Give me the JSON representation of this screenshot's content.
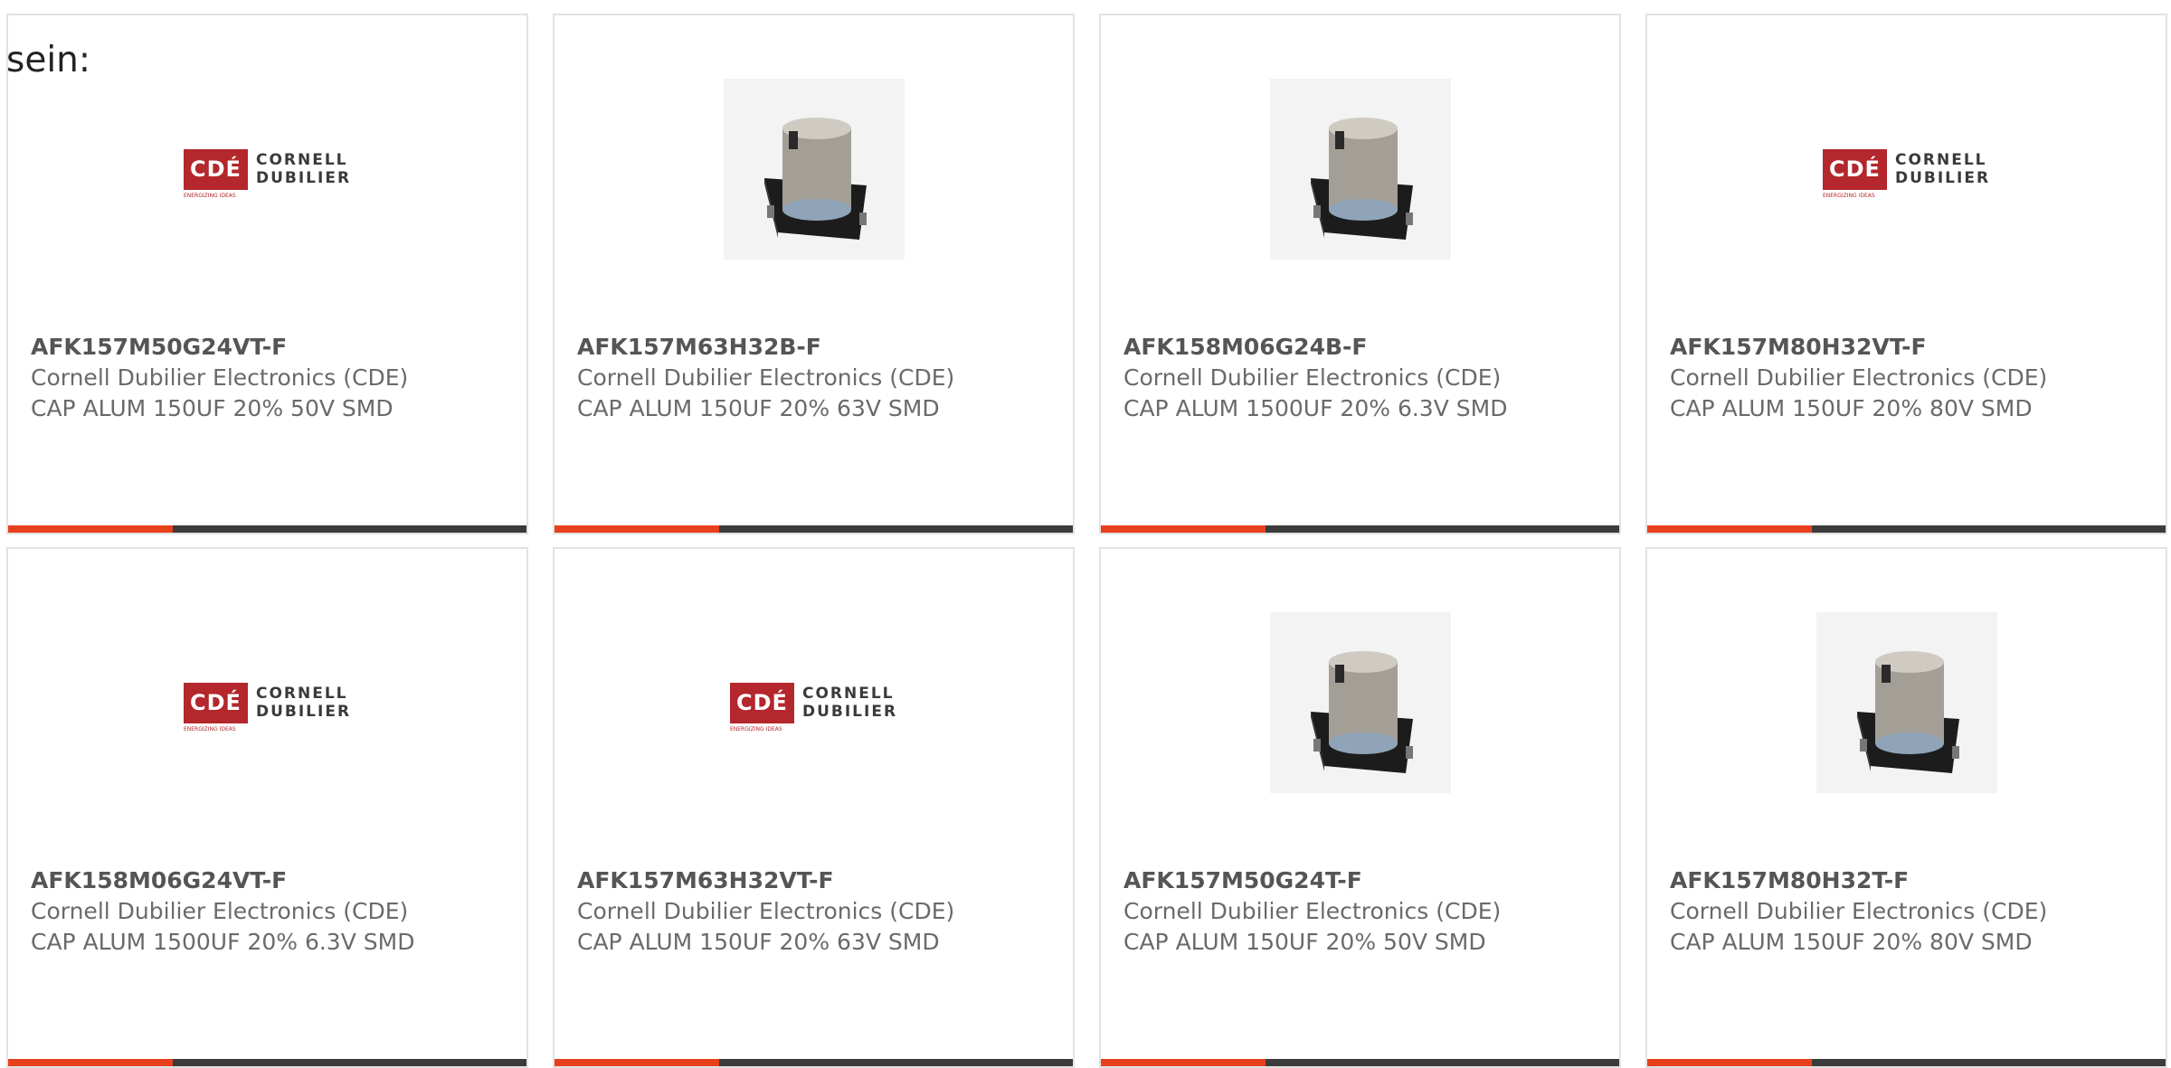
{
  "intro_text": "sein:",
  "accent_color": "#e8401d",
  "bar_color": "#3b3b3b",
  "logo": {
    "box_text": "CDÉ",
    "line1": "CORNELL",
    "line2": "DUBILIER",
    "tagline": "ENERGIZING IDEAS"
  },
  "products": [
    {
      "part_number": "AFK157M50G24VT-F",
      "manufacturer": "Cornell Dubilier Electronics (CDE)",
      "description": "CAP ALUM 150UF 20% 50V SMD",
      "image": "cde-logo"
    },
    {
      "part_number": "AFK157M63H32B-F",
      "manufacturer": "Cornell Dubilier Electronics (CDE)",
      "description": "CAP ALUM 150UF 20% 63V SMD",
      "image": "capacitor-photo"
    },
    {
      "part_number": "AFK158M06G24B-F",
      "manufacturer": "Cornell Dubilier Electronics (CDE)",
      "description": "CAP ALUM 1500UF 20% 6.3V SMD",
      "image": "capacitor-photo"
    },
    {
      "part_number": "AFK157M80H32VT-F",
      "manufacturer": "Cornell Dubilier Electronics (CDE)",
      "description": "CAP ALUM 150UF 20% 80V SMD",
      "image": "cde-logo"
    },
    {
      "part_number": "AFK158M06G24VT-F",
      "manufacturer": "Cornell Dubilier Electronics (CDE)",
      "description": "CAP ALUM 1500UF 20% 6.3V SMD",
      "image": "cde-logo"
    },
    {
      "part_number": "AFK157M63H32VT-F",
      "manufacturer": "Cornell Dubilier Electronics (CDE)",
      "description": "CAP ALUM 150UF 20% 63V SMD",
      "image": "cde-logo"
    },
    {
      "part_number": "AFK157M50G24T-F",
      "manufacturer": "Cornell Dubilier Electronics (CDE)",
      "description": "CAP ALUM 150UF 20% 50V SMD",
      "image": "capacitor-photo"
    },
    {
      "part_number": "AFK157M80H32T-F",
      "manufacturer": "Cornell Dubilier Electronics (CDE)",
      "description": "CAP ALUM 150UF 20% 80V SMD",
      "image": "capacitor-photo"
    }
  ]
}
